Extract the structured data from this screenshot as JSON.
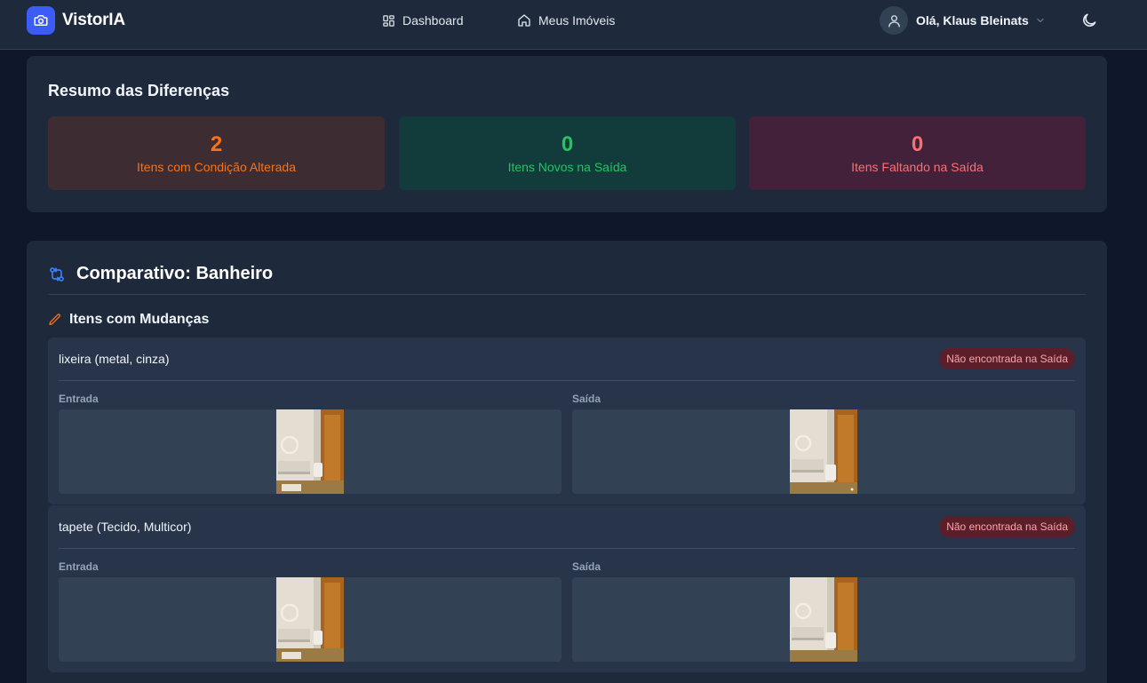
{
  "app": {
    "name": "VistorIA"
  },
  "nav": {
    "dashboard": "Dashboard",
    "imoveis": "Meus Imóveis"
  },
  "user": {
    "greeting": "Olá, Klaus Bleinats"
  },
  "summary": {
    "title": "Resumo das Diferenças",
    "stats": [
      {
        "value": "2",
        "label": "Itens com Condição Alterada",
        "color": "#f97316"
      },
      {
        "value": "0",
        "label": "Itens Novos na Saída",
        "color": "#22c55e"
      },
      {
        "value": "0",
        "label": "Itens Faltando na Saída",
        "color": "#f87171"
      }
    ]
  },
  "comparison": {
    "title": "Comparativo: Banheiro",
    "changes_title": "Itens com Mudanças",
    "items": [
      {
        "name": "lixeira (metal, cinza)",
        "badge": "Não encontrada na Saída",
        "entry_label": "Entrada",
        "exit_label": "Saída"
      },
      {
        "name": "tapete (Tecido, Multicor)",
        "badge": "Não encontrada na Saída",
        "entry_label": "Entrada",
        "exit_label": "Saída"
      }
    ]
  },
  "colors": {
    "accent": "#3b5cf6",
    "background": "#0f172a",
    "card": "#1e293b",
    "badge_bg": "#5b1f2c",
    "badge_text": "#fca5a5"
  },
  "icons": [
    "camera-icon",
    "grid-icon",
    "home-icon",
    "user-icon",
    "chevron-down-icon",
    "moon-icon",
    "compare-arrows-icon",
    "pencil-icon"
  ]
}
